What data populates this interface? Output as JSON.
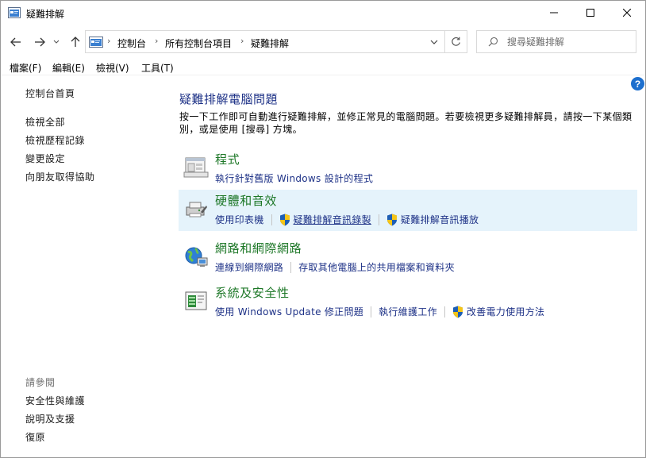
{
  "window": {
    "title": "疑難排解"
  },
  "nav": {
    "breadcrumbs": [
      "控制台",
      "所有控制台項目",
      "疑難排解"
    ],
    "search_placeholder": "搜尋疑難排解"
  },
  "menu": {
    "items": [
      "檔案(F)",
      "編輯(E)",
      "檢視(V)",
      "工具(T)"
    ]
  },
  "sidebar": {
    "links": [
      "控制台首頁",
      "檢視全部",
      "檢視歷程記錄",
      "變更設定",
      "向朋友取得協助"
    ],
    "see_also_header": "請參閱",
    "see_also": [
      "安全性與維護",
      "說明及支援",
      "復原"
    ]
  },
  "main": {
    "title": "疑難排解電腦問題",
    "description": "按一下工作即可自動進行疑難排解，並修正常見的電腦問題。若要檢視更多疑難排解員，請按一下某個類別，或是使用 [搜尋] 方塊。",
    "categories": [
      {
        "title": "程式",
        "links": [
          "執行針對舊版 Windows 設計的程式"
        ]
      },
      {
        "title": "硬體和音效",
        "links": [
          "使用印表機",
          "疑難排解音訊錄製",
          "疑難排解音訊播放"
        ]
      },
      {
        "title": "網路和網際網路",
        "links": [
          "連線到網際網路",
          "存取其他電腦上的共用檔案和資料夾"
        ]
      },
      {
        "title": "系統及安全性",
        "links": [
          "使用 Windows Update 修正問題",
          "執行維護工作",
          "改善電力使用方法"
        ]
      }
    ]
  },
  "colors": {
    "link": "#1e3287",
    "category_title": "#1e7828",
    "highlight": "#e5f3fb",
    "help": "#1d6fce"
  }
}
